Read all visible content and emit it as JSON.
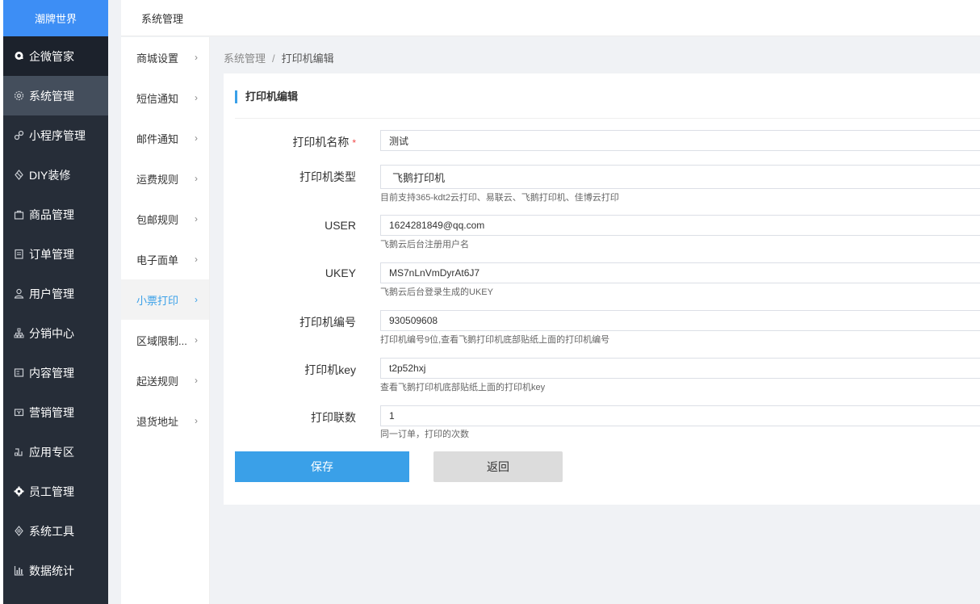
{
  "brand": "潮牌世界",
  "sidebar": {
    "items": [
      {
        "label": "企微管家",
        "icon": "qiwei-icon"
      },
      {
        "label": "系统管理",
        "icon": "gear-icon"
      },
      {
        "label": "小程序管理",
        "icon": "link-icon"
      },
      {
        "label": "DIY装修",
        "icon": "diy-icon"
      },
      {
        "label": "商品管理",
        "icon": "bag-icon"
      },
      {
        "label": "订单管理",
        "icon": "clipboard-icon"
      },
      {
        "label": "用户管理",
        "icon": "user-icon"
      },
      {
        "label": "分销中心",
        "icon": "hierarchy-icon"
      },
      {
        "label": "内容管理",
        "icon": "document-icon"
      },
      {
        "label": "营销管理",
        "icon": "ticket-icon"
      },
      {
        "label": "应用专区",
        "icon": "apps-icon"
      },
      {
        "label": "员工管理",
        "icon": "staff-gear-icon"
      },
      {
        "label": "系统工具",
        "icon": "tools-icon"
      },
      {
        "label": "数据统计",
        "icon": "chart-icon"
      }
    ]
  },
  "topbar": {
    "title": "系统管理"
  },
  "submenu": {
    "items": [
      {
        "label": "商城设置"
      },
      {
        "label": "短信通知"
      },
      {
        "label": "邮件通知"
      },
      {
        "label": "运费规则"
      },
      {
        "label": "包邮规则"
      },
      {
        "label": "电子面单"
      },
      {
        "label": "小票打印"
      },
      {
        "label": "区域限制..."
      },
      {
        "label": "起送规则"
      },
      {
        "label": "退货地址"
      }
    ],
    "arrow": "›"
  },
  "breadcrumb": {
    "parent": "系统管理",
    "sep": "/",
    "current": "打印机编辑"
  },
  "form": {
    "title": "打印机编辑",
    "required_mark": "*",
    "name": {
      "label": "打印机名称",
      "value": "测试"
    },
    "type": {
      "label": "打印机类型",
      "value": "飞鹅打印机",
      "hint": "目前支持365-kdt2云打印、易联云、飞鹅打印机、佳博云打印"
    },
    "user": {
      "label": "USER",
      "value": "1624281849@qq.com",
      "hint": "飞鹅云后台注册用户名"
    },
    "ukey": {
      "label": "UKEY",
      "value": "MS7nLnVmDyrAt6J7",
      "hint": "飞鹅云后台登录生成的UKEY"
    },
    "sn": {
      "label": "打印机编号",
      "value": "930509608",
      "hint": "打印机编号9位,查看飞鹅打印机底部贴纸上面的打印机编号"
    },
    "key": {
      "label": "打印机key",
      "value": "t2p52hxj",
      "hint": "查看飞鹅打印机底部贴纸上面的打印机key"
    },
    "times": {
      "label": "打印联数",
      "value": "1",
      "hint": "同一订单，打印的次数"
    },
    "save_label": "保存",
    "back_label": "返回"
  }
}
